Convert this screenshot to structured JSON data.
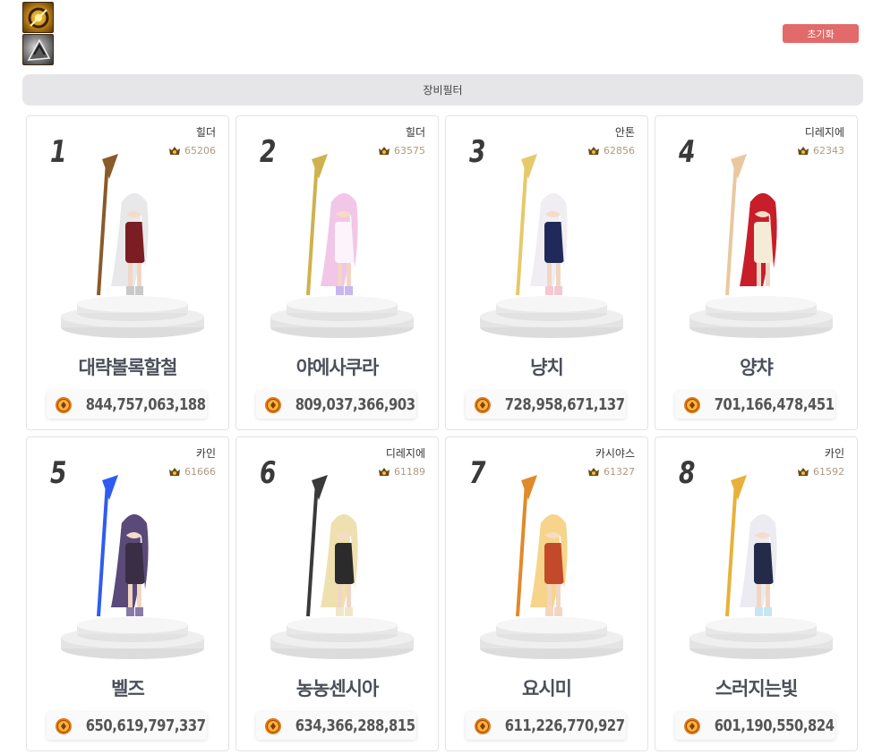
{
  "header": {
    "reset_label": "초기화",
    "filter_label": "장비필터",
    "top_icons": [
      "gold-mythic-item-icon",
      "gray-item-icon"
    ]
  },
  "colors": {
    "reset_button": "#e26a6a",
    "filter_bar": "#e6e6e8",
    "fame_text": "#b09a80",
    "name_text": "#4a4f5a"
  },
  "ranking": [
    {
      "rank": "1",
      "server": "힐더",
      "fame": "65206",
      "name": "대략볼록할철",
      "damage": "844,757,063,188",
      "art": "hair-white-scythe"
    },
    {
      "rank": "2",
      "server": "힐더",
      "fame": "63575",
      "name": "야에사쿠라",
      "damage": "809,037,366,903",
      "art": "hair-pink-lance"
    },
    {
      "rank": "3",
      "server": "안톤",
      "fame": "62856",
      "name": "냥치",
      "damage": "728,958,671,137",
      "art": "hair-white-cat"
    },
    {
      "rank": "4",
      "server": "디레지에",
      "fame": "62343",
      "name": "양챠",
      "damage": "701,166,478,451",
      "art": "hair-red-chick"
    },
    {
      "rank": "5",
      "server": "카인",
      "fame": "61666",
      "name": "벨즈",
      "damage": "650,619,797,337",
      "art": "hair-purple-trident"
    },
    {
      "rank": "6",
      "server": "디레지에",
      "fame": "61189",
      "name": "농농센시아",
      "damage": "634,366,288,815",
      "art": "hair-blonde-spear"
    },
    {
      "rank": "7",
      "server": "카시야스",
      "fame": "61327",
      "name": "요시미",
      "damage": "611,226,770,927",
      "art": "hair-blonde-mace"
    },
    {
      "rank": "8",
      "server": "카인",
      "fame": "61592",
      "name": "스러지는빛",
      "damage": "601,190,550,824",
      "art": "hair-white-staff"
    }
  ]
}
